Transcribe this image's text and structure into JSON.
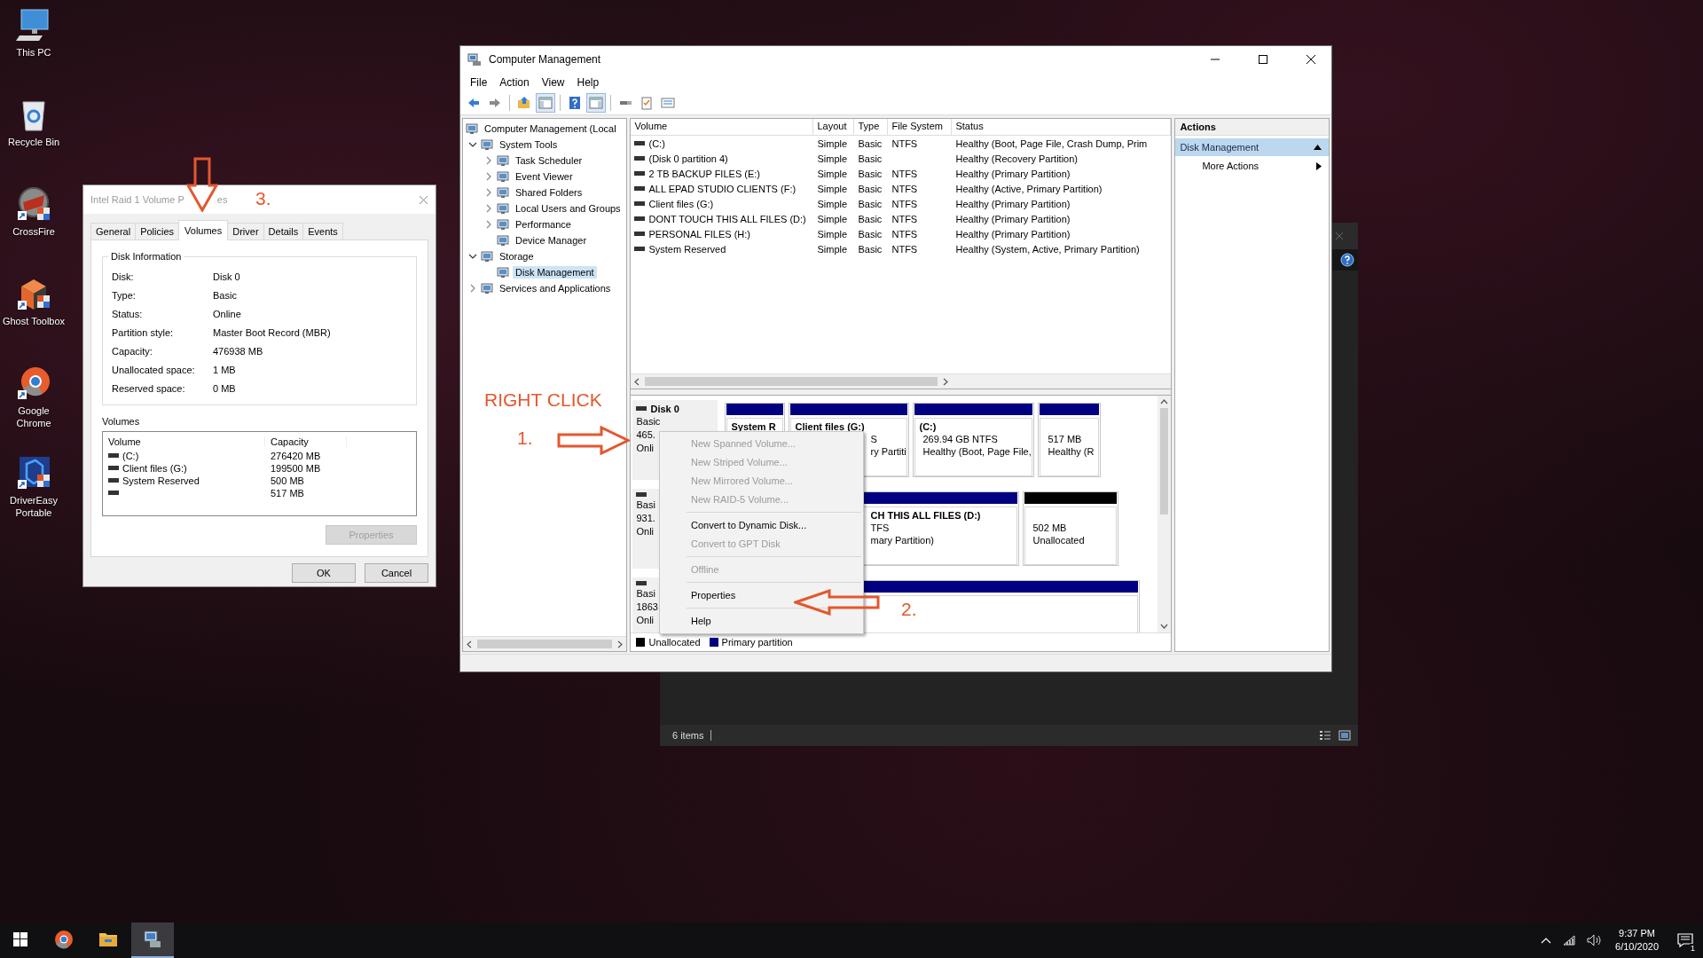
{
  "desktop_icons": [
    {
      "label": "This PC",
      "kind": "monitor"
    },
    {
      "label": "Recycle Bin",
      "kind": "bin"
    },
    {
      "label": "CrossFire",
      "kind": "emblem"
    },
    {
      "label": "Ghost Toolbox",
      "kind": "cube"
    },
    {
      "label": "Google Chrome",
      "kind": "browser"
    },
    {
      "label": "DriverEasy Portable",
      "kind": "driver"
    }
  ],
  "background_window": {
    "status": "6 items"
  },
  "computer_management": {
    "title": "Computer Management",
    "menu": [
      "File",
      "Action",
      "View",
      "Help"
    ],
    "toolbar": [
      {
        "kind": "back",
        "pressed": false
      },
      {
        "kind": "forward",
        "pressed": false
      },
      {
        "kind": "separator"
      },
      {
        "kind": "up",
        "pressed": false
      },
      {
        "kind": "tree",
        "pressed": true
      },
      {
        "kind": "separator"
      },
      {
        "kind": "help",
        "pressed": false
      },
      {
        "kind": "pane",
        "pressed": true
      },
      {
        "kind": "separator"
      },
      {
        "kind": "plug",
        "pressed": false
      },
      {
        "kind": "check",
        "pressed": false
      },
      {
        "kind": "list",
        "pressed": false
      }
    ],
    "tree": [
      {
        "label": "Computer Management (Local",
        "selected": false,
        "children": [
          {
            "label": "System Tools",
            "expanded": true,
            "selected": false,
            "children": [
              {
                "label": "Task Scheduler",
                "expanded": false,
                "selected": false
              },
              {
                "label": "Event Viewer",
                "expanded": false,
                "selected": false
              },
              {
                "label": "Shared Folders",
                "expanded": false,
                "selected": false
              },
              {
                "label": "Local Users and Groups",
                "expanded": false,
                "selected": false
              },
              {
                "label": "Performance",
                "expanded": false,
                "selected": false
              },
              {
                "label": "Device Manager",
                "selected": false
              }
            ]
          },
          {
            "label": "Storage",
            "expanded": true,
            "selected": false,
            "children": [
              {
                "label": "Disk Management",
                "selected": true
              }
            ]
          },
          {
            "label": "Services and Applications",
            "expanded": false,
            "selected": false
          }
        ]
      }
    ],
    "volume_columns": [
      "Volume",
      "Layout",
      "Type",
      "File System",
      "Status"
    ],
    "volumes": [
      {
        "volume": "(C:)",
        "layout": "Simple",
        "type": "Basic",
        "file_system": "NTFS",
        "status": "Healthy (Boot, Page File, Crash Dump, Prim"
      },
      {
        "volume": "(Disk 0 partition 4)",
        "layout": "Simple",
        "type": "Basic",
        "status": "Healthy (Recovery Partition)"
      },
      {
        "volume": "2 TB BACKUP FILES (E:)",
        "layout": "Simple",
        "type": "Basic",
        "file_system": "NTFS",
        "status": "Healthy (Primary Partition)"
      },
      {
        "volume": "ALL EPAD STUDIO CLIENTS (F:)",
        "layout": "Simple",
        "type": "Basic",
        "file_system": "NTFS",
        "status": "Healthy (Active, Primary Partition)"
      },
      {
        "volume": "Client files (G:)",
        "layout": "Simple",
        "type": "Basic",
        "file_system": "NTFS",
        "status": "Healthy (Primary Partition)"
      },
      {
        "volume": "DONT TOUCH THIS ALL FILES (D:)",
        "layout": "Simple",
        "type": "Basic",
        "file_system": "NTFS",
        "status": "Healthy (Primary Partition)"
      },
      {
        "volume": "PERSONAL FILES (H:)",
        "layout": "Simple",
        "type": "Basic",
        "file_system": "NTFS",
        "status": "Healthy (Primary Partition)"
      },
      {
        "volume": "System Reserved",
        "layout": "Simple",
        "type": "Basic",
        "file_system": "NTFS",
        "status": "Healthy (System, Active, Primary Partition)"
      }
    ],
    "disks": [
      {
        "name": "Disk 0",
        "lines": [
          "Basic",
          "465.",
          "Onli"
        ],
        "partitions": [
          {
            "kind": "primary",
            "title": "System R"
          },
          {
            "kind": "primary",
            "title": "Client files  (G:)",
            "lines": [
              "S",
              "ry Partiti"
            ]
          },
          {
            "kind": "primary",
            "title": "(C:)",
            "lines": [
              "269.94 GB NTFS",
              "Healthy (Boot, Page File,"
            ]
          },
          {
            "kind": "primary",
            "lines": [
              "517 MB",
              "Healthy (R"
            ]
          }
        ]
      },
      {
        "lines": [
          "Basi",
          "931.",
          "Onli"
        ],
        "partitions": [
          {
            "kind": "primary",
            "title": "CH THIS ALL FILES  (D:)",
            "lines": [
              "TFS",
              "mary Partition)"
            ]
          },
          {
            "kind": "unallocated",
            "lines": [
              "502 MB",
              "Unallocated"
            ]
          }
        ]
      },
      {
        "lines": [
          "Basi",
          "1863",
          "Onli"
        ],
        "partitions": [
          {
            "kind": "primary"
          }
        ]
      }
    ],
    "legend": [
      {
        "label": "Unallocated",
        "color": "#000000"
      },
      {
        "label": "Primary partition",
        "color": "#000080"
      }
    ],
    "actions": {
      "title": "Actions",
      "section": {
        "label": "Disk Management",
        "expanded": true
      },
      "items": [
        "More Actions"
      ]
    }
  },
  "context_menu": [
    {
      "kind": "item",
      "label": "New Spanned Volume...",
      "disabled": true
    },
    {
      "kind": "item",
      "label": "New Striped Volume...",
      "disabled": true
    },
    {
      "kind": "item",
      "label": "New Mirrored Volume...",
      "disabled": true
    },
    {
      "kind": "item",
      "label": "New RAID-5 Volume...",
      "disabled": true
    },
    {
      "kind": "separator"
    },
    {
      "kind": "item",
      "label": "Convert to Dynamic Disk...",
      "disabled": false
    },
    {
      "kind": "item",
      "label": "Convert to GPT Disk",
      "disabled": true
    },
    {
      "kind": "separator"
    },
    {
      "kind": "item",
      "label": "Offline",
      "disabled": true
    },
    {
      "kind": "separator"
    },
    {
      "kind": "item",
      "label": "Properties",
      "disabled": false
    },
    {
      "kind": "separator"
    },
    {
      "kind": "item",
      "label": "Help",
      "disabled": false
    }
  ],
  "properties_dialog": {
    "title_parts": [
      "Intel Raid 1 Volume P",
      "es"
    ],
    "tabs": [
      {
        "label": "General",
        "selected": false
      },
      {
        "label": "Policies",
        "selected": false
      },
      {
        "label": "Volumes",
        "selected": true
      },
      {
        "label": "Driver",
        "selected": false
      },
      {
        "label": "Details",
        "selected": false
      },
      {
        "label": "Events",
        "selected": false
      }
    ],
    "group_title": "Disk Information",
    "info": [
      {
        "label": "Disk:",
        "value": "Disk 0"
      },
      {
        "label": "Type:",
        "value": "Basic"
      },
      {
        "label": "Status:",
        "value": "Online"
      },
      {
        "label": "Partition style:",
        "value": "Master Boot Record (MBR)"
      },
      {
        "label": "Capacity:",
        "value": "476938 MB"
      },
      {
        "label": "Unallocated space:",
        "value": "1 MB"
      },
      {
        "label": "Reserved space:",
        "value": "0 MB"
      }
    ],
    "volumes_label": "Volumes",
    "volume_columns": [
      "Volume",
      "Capacity"
    ],
    "volumes": [
      {
        "name": "(C:)",
        "capacity": "276420 MB"
      },
      {
        "name": "Client files (G:)",
        "capacity": "199500 MB"
      },
      {
        "name": "System Reserved",
        "capacity": "500 MB"
      },
      {
        "capacity": "517 MB"
      }
    ],
    "properties_button": {
      "label": "Properties",
      "disabled": true
    },
    "buttons": [
      "OK",
      "Cancel"
    ]
  },
  "annotations": {
    "right_click": "RIGHT CLICK",
    "step_1": "1.",
    "step_2": "2.",
    "step_3": "3."
  },
  "taskbar": {
    "apps": [
      {
        "kind": "browser",
        "active": false
      },
      {
        "kind": "folder",
        "active": false
      },
      {
        "kind": "manager",
        "active": true
      }
    ],
    "time": "9:37 PM",
    "date": "6/10/2020",
    "notifications": "1"
  }
}
